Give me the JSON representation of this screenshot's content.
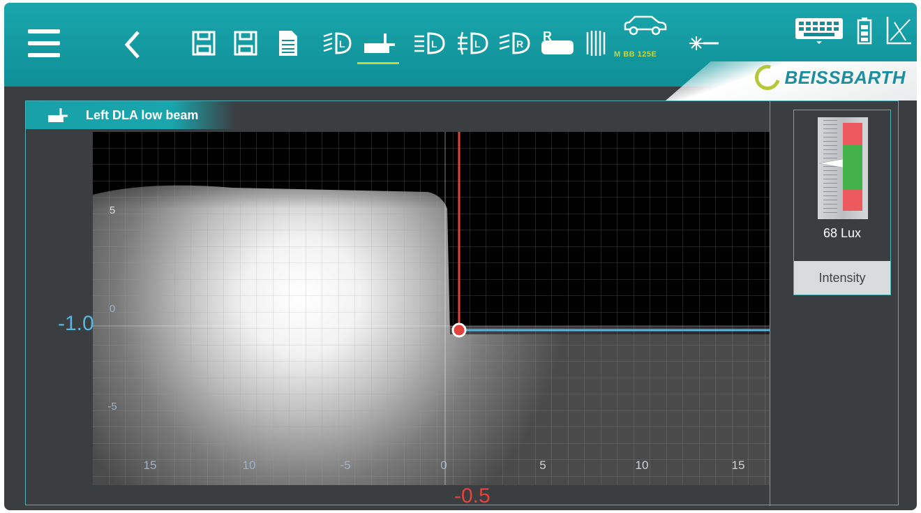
{
  "toolbar": {
    "active_tab": "low-beam-left",
    "car_label": "M BB 125E",
    "accent_color": "#c7d53a",
    "bar_color": "#1aa6ad",
    "icons": [
      "menu-icon",
      "back-arrow-icon",
      "save-icon",
      "save-as-icon",
      "document-icon",
      "low-beam-icon",
      "low-beam-left-icon",
      "high-beam-icon",
      "fog-light-icon",
      "fog-rear-icon",
      "right-hand-traffic-icon",
      "lamp-array-icon",
      "car-icon",
      "laser-icon",
      "keyboard-icon",
      "battery-icon",
      "chart-icon"
    ]
  },
  "brand": {
    "name": "BEISSBARTH"
  },
  "panel": {
    "title": "Left DLA low beam",
    "y_value": "-1.0",
    "x_value": "-0.5"
  },
  "intensity": {
    "lux": "68 Lux",
    "button_label": "Intensity",
    "level_fraction": 0.45
  },
  "plot": {
    "x_ticks": [
      "15",
      "10",
      "-5",
      "0",
      "5",
      "10",
      "15"
    ],
    "y_ticks": [
      "5",
      "0",
      "-5"
    ],
    "vertical_line_color": "#e2443c",
    "horizontal_line_color": "#5bb6df"
  }
}
